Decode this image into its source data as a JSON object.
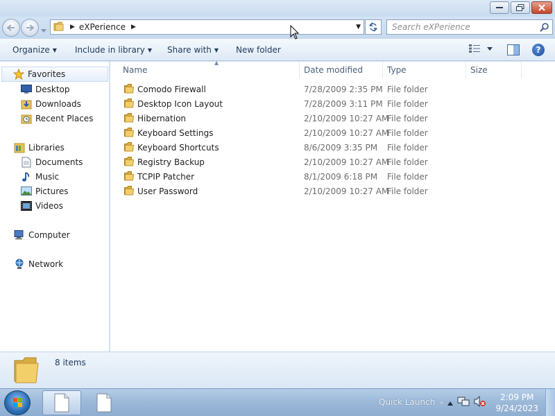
{
  "window": {
    "title": "",
    "controls": {
      "minimize": "minimize",
      "maximize": "maximize",
      "close": "close"
    }
  },
  "address": {
    "crumb": "eXPerience",
    "search_placeholder": "Search eXPerience"
  },
  "toolbar": {
    "organize": "Organize",
    "include_in_library": "Include in library",
    "share_with": "Share with",
    "new_folder": "New folder"
  },
  "sidebar": {
    "favorites": {
      "label": "Favorites",
      "items": [
        {
          "label": "Desktop",
          "icon": "desktop-icon"
        },
        {
          "label": "Downloads",
          "icon": "downloads-icon"
        },
        {
          "label": "Recent Places",
          "icon": "recent-places-icon"
        }
      ]
    },
    "libraries": {
      "label": "Libraries",
      "items": [
        {
          "label": "Documents",
          "icon": "documents-icon"
        },
        {
          "label": "Music",
          "icon": "music-icon"
        },
        {
          "label": "Pictures",
          "icon": "pictures-icon"
        },
        {
          "label": "Videos",
          "icon": "videos-icon"
        }
      ]
    },
    "computer": "Computer",
    "network": "Network"
  },
  "columns": {
    "name": "Name",
    "date_modified": "Date modified",
    "type": "Type",
    "size": "Size"
  },
  "files": [
    {
      "name": "Comodo Firewall",
      "date": "7/28/2009 2:35 PM",
      "type": "File folder",
      "size": ""
    },
    {
      "name": "Desktop Icon Layout",
      "date": "7/28/2009 3:11 PM",
      "type": "File folder",
      "size": ""
    },
    {
      "name": "Hibernation",
      "date": "2/10/2009 10:27 AM",
      "type": "File folder",
      "size": ""
    },
    {
      "name": "Keyboard Settings",
      "date": "2/10/2009 10:27 AM",
      "type": "File folder",
      "size": ""
    },
    {
      "name": "Keyboard Shortcuts",
      "date": "8/6/2009 3:35 PM",
      "type": "File folder",
      "size": ""
    },
    {
      "name": "Registry Backup",
      "date": "2/10/2009 10:27 AM",
      "type": "File folder",
      "size": ""
    },
    {
      "name": "TCPIP Patcher",
      "date": "8/1/2009 6:18 PM",
      "type": "File folder",
      "size": ""
    },
    {
      "name": "User Password",
      "date": "2/10/2009 10:27 AM",
      "type": "File folder",
      "size": ""
    }
  ],
  "details": {
    "item_count": "8 items"
  },
  "taskbar": {
    "quick_launch": "Quick Launch",
    "clock_time": "2:09 PM",
    "clock_date": "9/24/2023"
  },
  "colors": {
    "accent": "#1e395b",
    "folder": "#e8c25a",
    "taskbar": "#9bb8d8"
  }
}
